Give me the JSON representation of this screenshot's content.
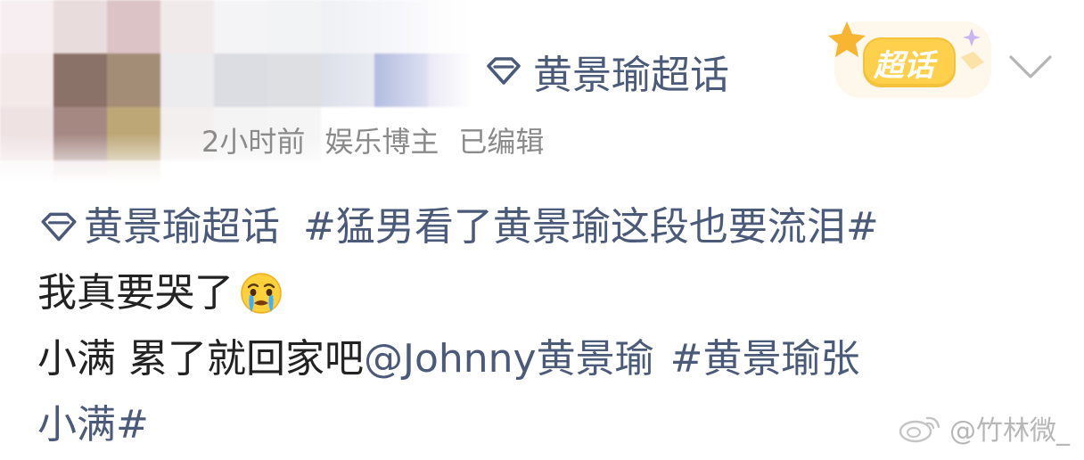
{
  "header": {
    "topic_label": "黄景瑜超话",
    "badge_label": "超话"
  },
  "meta": {
    "time": "2小时前",
    "role": "娱乐博主",
    "edited": "已编辑"
  },
  "content": {
    "topic_link": "黄景瑜超话",
    "hashtag_1": "#猛男看了黄景瑜这段也要流泪#",
    "line2_text": "我真要哭了",
    "emoji_name": "crying-face-emoji",
    "line3_text": "小满 累了就回家吧",
    "mention": "@Johnny黄景瑜",
    "hashtag_2_part1": "#黄景瑜张",
    "hashtag_2_part2": "小满#"
  },
  "watermark": {
    "text": "@竹林微_"
  },
  "colors": {
    "link": "#4a5a78",
    "meta": "#8a8a8a",
    "text": "#222222",
    "badge": "#f5c23b"
  }
}
